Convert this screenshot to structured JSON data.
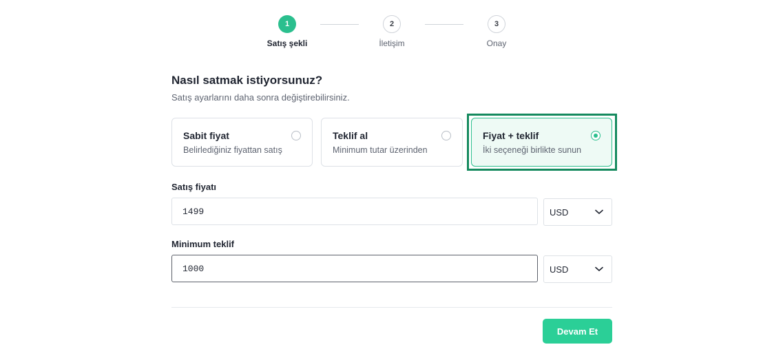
{
  "stepper": {
    "steps": [
      {
        "number": "1",
        "label": "Satış şekli",
        "state": "active"
      },
      {
        "number": "2",
        "label": "İletişim",
        "state": "inactive"
      },
      {
        "number": "3",
        "label": "Onay",
        "state": "inactive"
      }
    ]
  },
  "header": {
    "title": "Nasıl satmak istiyorsunuz?",
    "subtitle": "Satış ayarlarını daha sonra değiştirebilirsiniz."
  },
  "options": [
    {
      "title": "Sabit fiyat",
      "description": "Belirlediğiniz fiyattan satış",
      "selected": false
    },
    {
      "title": "Teklif al",
      "description": "Minimum tutar üzerinden",
      "selected": false
    },
    {
      "title": "Fiyat + teklif",
      "description": "İki seçeneği birlikte sunun",
      "selected": true
    }
  ],
  "price": {
    "label": "Satış fiyatı",
    "value": "1499",
    "currency": "USD"
  },
  "min_offer": {
    "label": "Minimum teklif",
    "value": "1000",
    "currency": "USD"
  },
  "actions": {
    "continue_label": "Devam Et"
  },
  "colors": {
    "accent": "#2bbf8e",
    "button": "#2bcf97",
    "highlight": "#148a5e"
  },
  "icons": {
    "select_arrow": "chevron-down-icon",
    "radio": "radio-icon"
  }
}
